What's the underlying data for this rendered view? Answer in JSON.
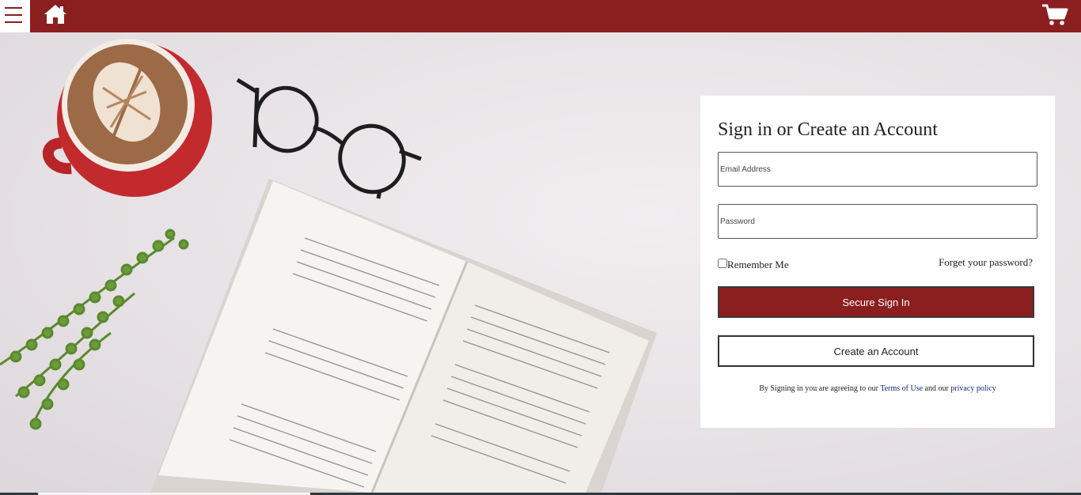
{
  "header": {
    "menu_icon": "hamburger-icon",
    "home_icon": "home-icon",
    "cart_icon": "cart-icon",
    "brand_color": "#8b1e1f"
  },
  "signin": {
    "title": "Sign in or Create an Account",
    "email_placeholder": "Email Address",
    "password_placeholder": "Password",
    "remember_label": "Remember Me",
    "forgot_label": "Forget your password?",
    "signin_button": "Secure Sign In",
    "create_button": "Create an Account",
    "terms_prefix": "By Signing in you are agreeing to our ",
    "terms_link": "Terms of Use",
    "terms_middle": " and our ",
    "privacy_link": "privacy policy"
  }
}
